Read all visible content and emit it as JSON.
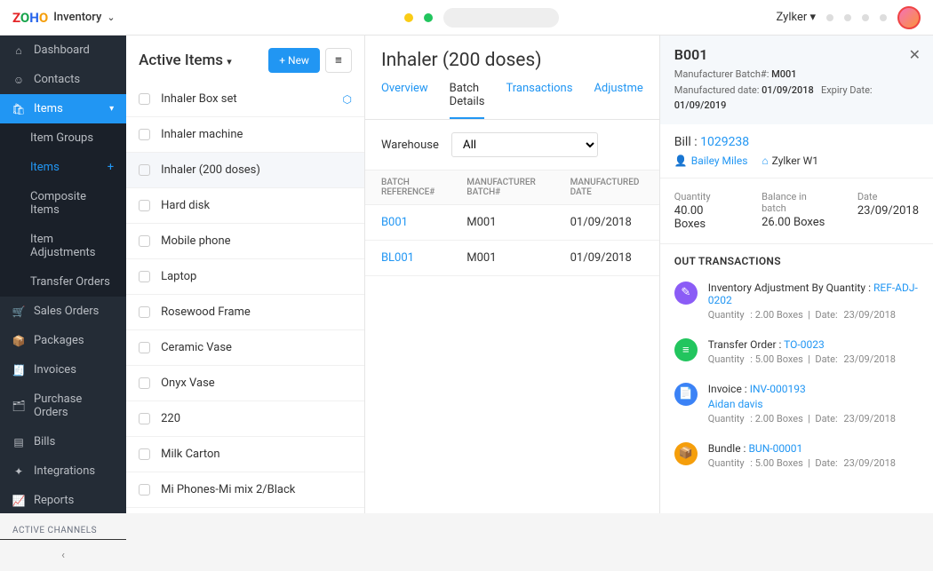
{
  "brand": {
    "name": "Inventory"
  },
  "org": "Zylker",
  "sidebar": {
    "dashboard": "Dashboard",
    "contacts": "Contacts",
    "items": "Items",
    "sub": {
      "groups": "Item Groups",
      "items": "Items",
      "composite": "Composite Items",
      "adjust": "Item Adjustments",
      "transfer": "Transfer Orders"
    },
    "sales": "Sales Orders",
    "packages": "Packages",
    "invoices": "Invoices",
    "po": "Purchase Orders",
    "bills": "Bills",
    "integrations": "Integrations",
    "reports": "Reports",
    "channels": "ACTIVE CHANNELS"
  },
  "items": {
    "title": "Active Items",
    "new": "+ New",
    "list": [
      "Inhaler Box set",
      "Inhaler machine",
      "Inhaler (200 doses)",
      "Hard disk",
      "Mobile phone",
      "Laptop",
      "Rosewood Frame",
      "Ceramic Vase",
      "Onyx Vase",
      "220",
      "Milk Carton",
      "Mi Phones-Mi mix 2/Black"
    ]
  },
  "detail": {
    "title": "Inhaler (200 doses)",
    "tabs": {
      "overview": "Overview",
      "batch": "Batch Details",
      "trans": "Transactions",
      "adjust": "Adjustme"
    },
    "wh_label": "Warehouse",
    "wh_value": "All",
    "cols": {
      "ref": "BATCH REFERENCE#",
      "mfg": "MANUFACTURER BATCH#",
      "date": "MANUFACTURED DATE"
    },
    "rows": [
      {
        "ref": "B001",
        "mfg": "M001",
        "date": "01/09/2018"
      },
      {
        "ref": "BL001",
        "mfg": "M001",
        "date": "01/09/2018"
      }
    ]
  },
  "panel": {
    "id": "B001",
    "mfg_label": "Manufacturer Batch#:",
    "mfg": "M001",
    "md_label": "Manufactured date:",
    "md": "01/09/2018",
    "ed_label": "Expiry Date:",
    "ed": "01/09/2019",
    "bill_label": "Bill :",
    "bill": "1029238",
    "contact": "Bailey Miles",
    "wh": "Zylker W1",
    "stats": [
      {
        "lbl": "Quantity",
        "val": "40.00 Boxes"
      },
      {
        "lbl": "Balance in batch",
        "val": "26.00 Boxes"
      },
      {
        "lbl": "Date",
        "val": "23/09/2018"
      }
    ],
    "out_label": "OUT TRANSACTIONS",
    "tx": [
      {
        "color": "c-purple",
        "icon": "✎",
        "t1": "Inventory Adjustment By Quantity : ",
        "ref": "REF-ADJ-0202",
        "sub": "",
        "qty": "2.00 Boxes",
        "date": "23/09/2018"
      },
      {
        "color": "c-green",
        "icon": "≡",
        "t1": "Transfer Order : ",
        "ref": "TO-0023",
        "sub": "",
        "qty": "5.00 Boxes",
        "date": "23/09/2018"
      },
      {
        "color": "c-blue",
        "icon": "📄",
        "t1": "Invoice : ",
        "ref": "INV-000193",
        "sub": "Aidan davis",
        "qty": "2.00 Boxes",
        "date": "23/09/2018"
      },
      {
        "color": "c-orange",
        "icon": "📦",
        "t1": "Bundle : ",
        "ref": "BUN-00001",
        "sub": "",
        "qty": "5.00 Boxes",
        "date": "23/09/2018"
      }
    ],
    "qty_lbl": "Quantity",
    "date_lbl": "Date:"
  }
}
